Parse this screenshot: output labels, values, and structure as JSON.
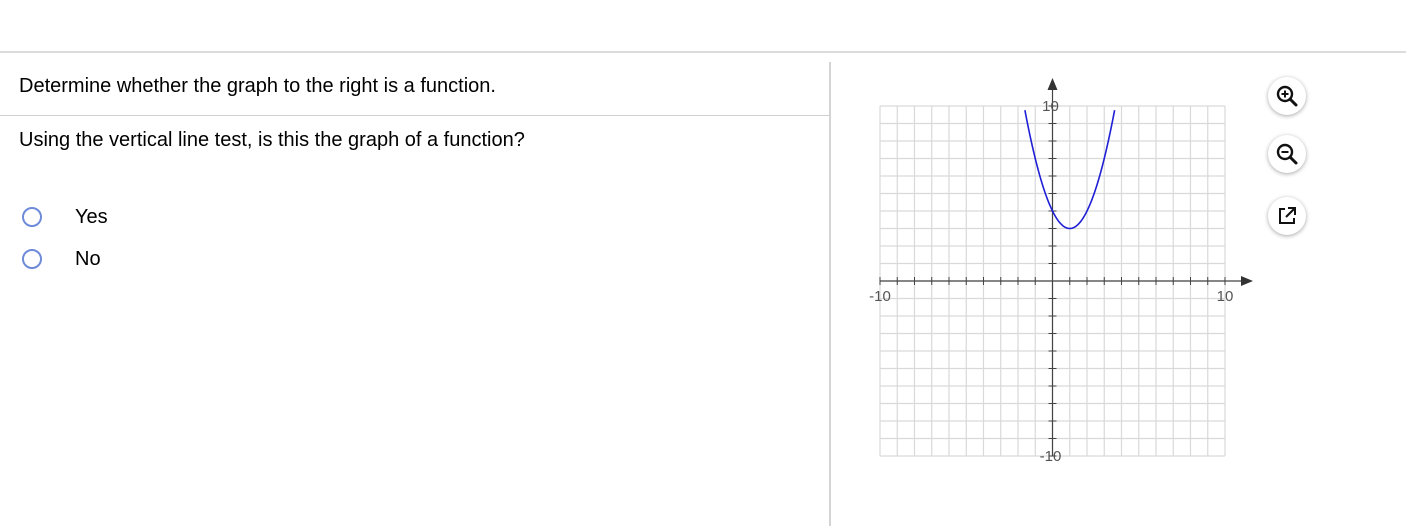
{
  "problem": {
    "instruction": "Determine whether the graph to the right is a function.",
    "question": "Using the vertical line test, is this the graph of a function?"
  },
  "choices": [
    {
      "label": "Yes"
    },
    {
      "label": "No"
    }
  ],
  "graph": {
    "x_min_label": "-10",
    "x_max_label": "10",
    "y_max_label": "10",
    "y_min_label": "-10",
    "xlim": [
      -10,
      10
    ],
    "ylim": [
      -10,
      10
    ],
    "grid": true,
    "curve_color": "#1f1fd6",
    "curve": {
      "type": "parabola",
      "vertex": [
        1,
        3
      ],
      "a": 1
    }
  },
  "tools": {
    "zoom_in_icon": "zoom-in-icon",
    "zoom_out_icon": "zoom-out-icon",
    "popout_icon": "popout-icon"
  }
}
